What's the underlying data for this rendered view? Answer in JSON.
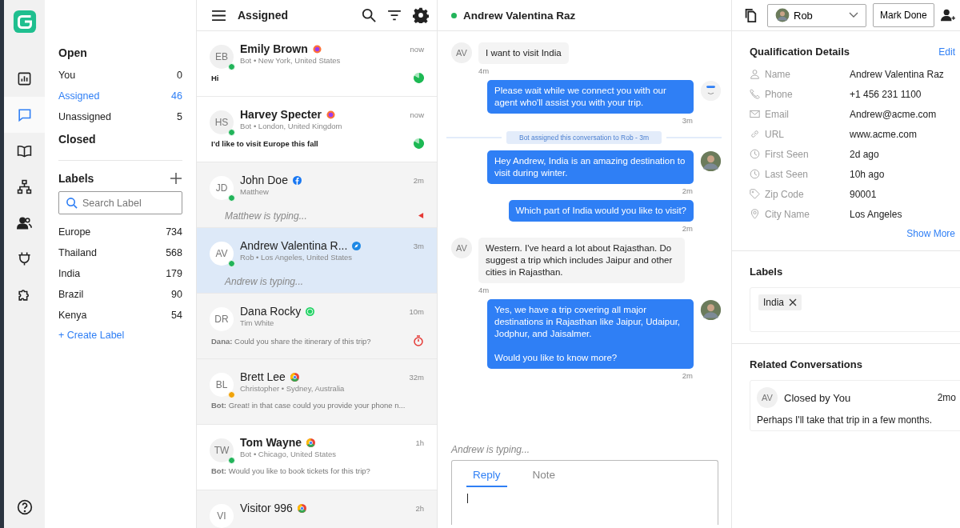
{
  "rail": {
    "items": [
      {
        "kind": "chart",
        "selected": false
      },
      {
        "kind": "chat",
        "selected": true
      },
      {
        "kind": "book",
        "selected": false
      },
      {
        "kind": "hierarchy",
        "selected": false
      },
      {
        "kind": "people",
        "selected": false
      },
      {
        "kind": "plug",
        "selected": false
      },
      {
        "kind": "puzzle",
        "selected": false
      }
    ]
  },
  "sidebar": {
    "open_heading": "Open",
    "items": [
      {
        "label": "You",
        "count": "0",
        "selected": false
      },
      {
        "label": "Assigned",
        "count": "46",
        "selected": true
      },
      {
        "label": "Unassigned",
        "count": "5",
        "selected": false
      }
    ],
    "closed_heading": "Closed",
    "labels_heading": "Labels",
    "search": {
      "placeholder": "Search Label"
    },
    "labels": [
      {
        "label": "Europe",
        "count": "734"
      },
      {
        "label": "Thailand",
        "count": "568"
      },
      {
        "label": "India",
        "count": "179"
      },
      {
        "label": "Brazil",
        "count": "90"
      },
      {
        "label": "Kenya",
        "count": "54"
      }
    ],
    "create_label": "+ Create Label"
  },
  "list": {
    "title": "Assigned",
    "conversations": [
      {
        "initials": "EB",
        "name": "Emily Brown",
        "channel": {
          "kind": "firefox"
        },
        "color": "#22b45a",
        "meta": "Bot • New York, United States",
        "time": "now",
        "preview": {
          "text": "Hi",
          "kind": "bold"
        },
        "indicator": {
          "kind": "pie"
        },
        "selected": false,
        "unread": true
      },
      {
        "initials": "HS",
        "name": "Harvey Specter",
        "channel": {
          "kind": "firefox"
        },
        "color": "#22b45a",
        "meta": "Bot • London, United Kingdom",
        "time": "now",
        "preview": {
          "text": "I'd like to visit Europe this fall",
          "kind": "bold"
        },
        "indicator": {
          "kind": "pie"
        },
        "selected": false,
        "unread": true
      },
      {
        "initials": "JD",
        "name": "John Doe",
        "channel": {
          "kind": "facebook"
        },
        "color": "#22b45a",
        "meta": "Matthew",
        "time": "2m",
        "preview": {
          "text": "Matthew is typing...",
          "kind": "typing"
        },
        "indicator": {
          "kind": "flag"
        },
        "selected": false,
        "unread": false
      },
      {
        "initials": "AV",
        "name": "Andrew Valentina R...",
        "channel": {
          "kind": "safari"
        },
        "color": "#22b45a",
        "meta": "Rob • Los Angeles, United States",
        "time": "3m",
        "preview": {
          "text": "Andrew is typing...",
          "kind": "typing"
        },
        "selected": true,
        "unread": false
      },
      {
        "initials": "DR",
        "name": "Dana Rocky",
        "channel": {
          "kind": "whatsapp"
        },
        "meta": "Tim White",
        "time": "10m",
        "preview": {
          "text": "**Dana:** Could you share the itinerary of this trip?",
          "kind": "plain"
        },
        "indicator": {
          "kind": "timer"
        },
        "selected": false,
        "unread": false
      },
      {
        "initials": "BL",
        "name": "Brett Lee",
        "channel": {
          "kind": "chrome"
        },
        "color": "#f0a30a",
        "meta": "Christopher • Sydney, Australia",
        "time": "32m",
        "preview": {
          "text": "**Bot:** Great! in that case could you provide your phone n...",
          "kind": "plain"
        },
        "selected": false,
        "unread": false
      },
      {
        "initials": "TW",
        "name": "Tom Wayne",
        "channel": {
          "kind": "chrome"
        },
        "color": "#22b45a",
        "meta": "Bot • Chicago, United States",
        "time": "1h",
        "preview": {
          "text": "**Bot:** Would you like to book tickets for this trip?",
          "kind": "plain"
        },
        "selected": false,
        "unread": true
      },
      {
        "initials": "VI",
        "name": "Visitor 996",
        "channel": {
          "kind": "chrome"
        },
        "time": "2h",
        "selected": false,
        "unread": false
      }
    ]
  },
  "chat": {
    "contact": "Andrew Valentina Raz",
    "assignee": "Rob",
    "mark_done": "Mark Done",
    "messages": [
      {
        "kind": "incoming",
        "initials": "AV",
        "text": "I want to visit India",
        "time": "4m"
      },
      {
        "kind": "outgoing",
        "avatar": {
          "kind": "bot"
        },
        "text": "Please wait while we connect you with our agent who'll assist you with your trip.",
        "time": "3m"
      },
      {
        "kind": "system",
        "text": "Bot assigned this conversation to Rob - 3m"
      },
      {
        "kind": "outgoing",
        "avatar": {
          "kind": "agent"
        },
        "text": "Hey Andrew, India is an amazing destination to visit during winter.",
        "time": "2m"
      },
      {
        "kind": "outgoing",
        "text": "Which part of India would you like to visit?",
        "time": "2m"
      },
      {
        "kind": "incoming",
        "initials": "AV",
        "text": "Western. I've heard a lot about Rajasthan. Do suggest a trip which includes Jaipur and other cities in Rajasthan.",
        "time": "4m"
      },
      {
        "kind": "outgoing",
        "avatar": {
          "kind": "agent"
        },
        "text": "Yes, we have a trip covering all major destinations in Rajasthan like Jaipur, Udaipur, Jodphur, and Jaisalmer.\n\nWould you like to know more?",
        "time": "2m"
      }
    ],
    "typing": "Andrew is typing...",
    "composer_tabs": [
      {
        "label": "Reply",
        "selected": true
      },
      {
        "label": "Note",
        "selected": false
      }
    ]
  },
  "details": {
    "title": "Qualification Details",
    "edit": "Edit",
    "fields": [
      {
        "kind": "user",
        "label": "Name",
        "value": "Andrew Valentina Raz"
      },
      {
        "kind": "phone",
        "label": "Phone",
        "value": "+1 456 231 1100"
      },
      {
        "kind": "mail",
        "label": "Email",
        "value": "Andrew@acme.com"
      },
      {
        "kind": "link",
        "label": "URL",
        "value": "www.acme.com"
      },
      {
        "kind": "clock",
        "label": "First Seen",
        "value": "2d ago"
      },
      {
        "kind": "clock",
        "label": "Last Seen",
        "value": "10h ago"
      },
      {
        "kind": "tag",
        "label": "Zip Code",
        "value": "90001"
      },
      {
        "kind": "pin",
        "label": "City Name",
        "value": "Los Angeles"
      }
    ],
    "show_more": "Show More",
    "labels_heading": "Labels",
    "labels": [
      "India"
    ],
    "related_heading": "Related Conversations",
    "related": [
      {
        "initials": "AV",
        "title": "Closed by You",
        "time": "2mo",
        "preview": "Perhaps I'll take that trip in a few months."
      }
    ]
  }
}
